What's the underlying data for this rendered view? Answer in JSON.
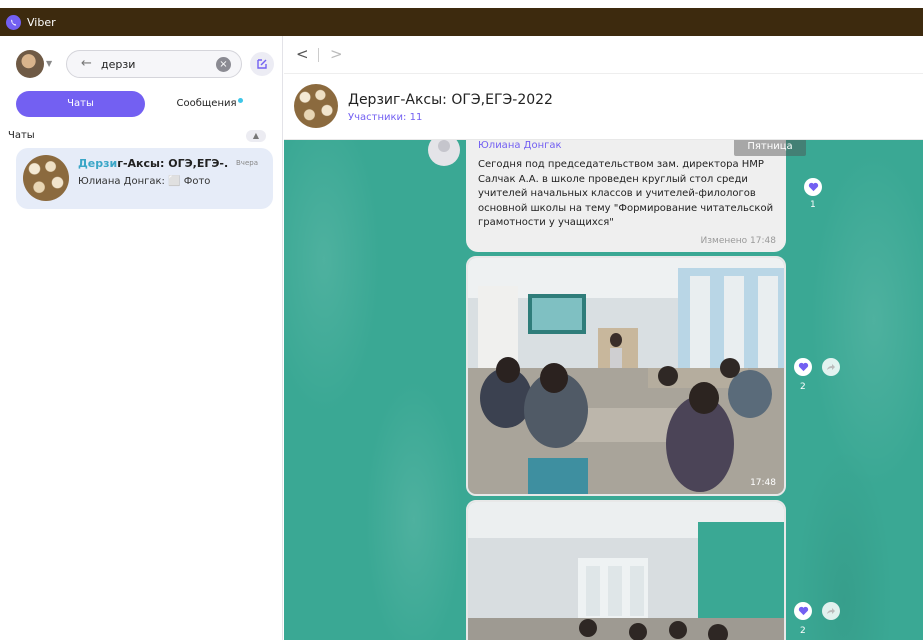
{
  "app": {
    "title": "Viber"
  },
  "sidebar": {
    "search": {
      "value": "дерзи"
    },
    "tabs": [
      {
        "label": "Чаты",
        "active": true
      },
      {
        "label": "Сообщения",
        "active": false
      }
    ],
    "section_label": "Чаты",
    "chat": {
      "name_highlight": "Дерзи",
      "name_rest": "г-Аксы: ОГЭ,ЕГЭ-...",
      "time": "Вчера",
      "preview": "Юлиана Донгак: ⬜ Фото"
    }
  },
  "header": {
    "title": "Дерзиг-Аксы: ОГЭ,ЕГЭ-2022",
    "subtitle": "Участники: 11"
  },
  "messages": {
    "sender": "Юлиана Донгак",
    "day": "Пятница",
    "text": "Сегодня под председательством зам. директора НМР Салчак А.А. в школе проведен круглый стол среди учителей начальных классов и учителей-филологов основной школы на тему \"Формирование читательской грамотности у учащихся\"",
    "edited": "Изменено 17:48",
    "text_reaction_count": "1",
    "photo1_time": "17:48",
    "photo1_reaction_count": "2",
    "photo2_reaction_count": "2"
  },
  "colors": {
    "accent": "#7360f2",
    "chat_background": "#3aa894",
    "highlight": "#3aa6c7",
    "titlebar": "#3d2a0e"
  }
}
